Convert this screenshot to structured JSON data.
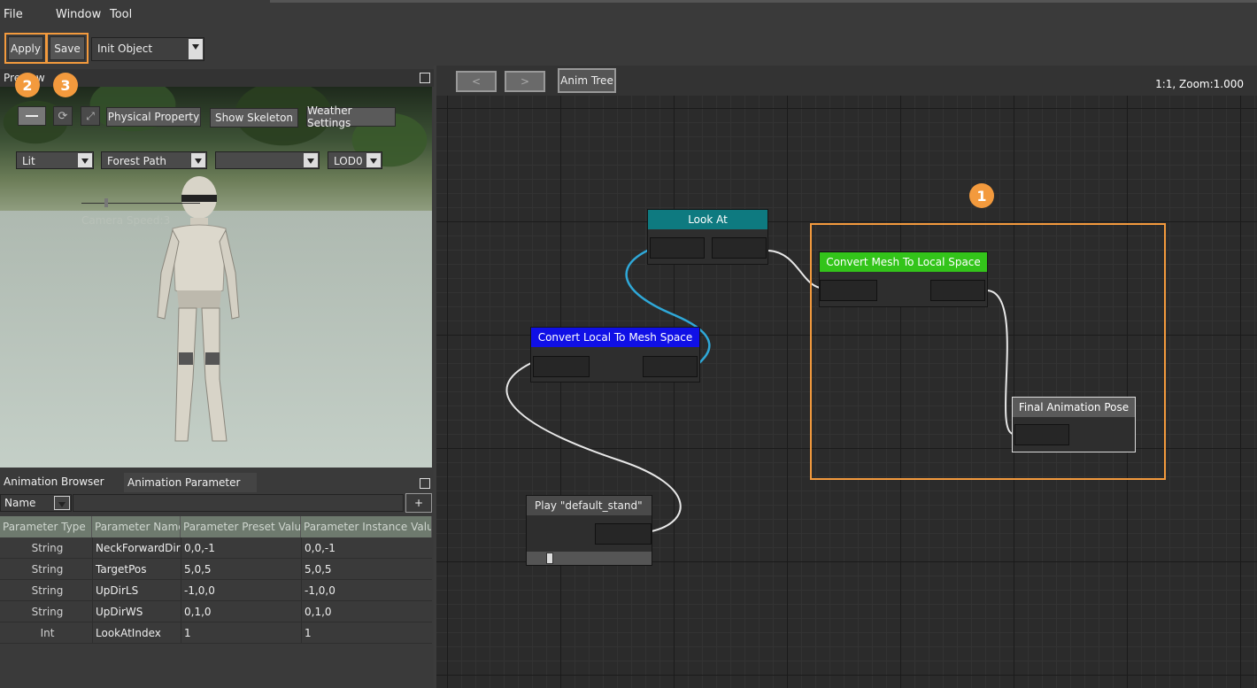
{
  "menu": {
    "file": "File",
    "window": "Window",
    "tool": "Tool"
  },
  "toolbar": {
    "apply": "Apply",
    "save": "Save",
    "object_select": "Init Object"
  },
  "badges": {
    "one": "1",
    "two": "2",
    "three": "3"
  },
  "preview": {
    "title": "Preview",
    "buttons": {
      "physical_property": "Physical Property",
      "show_skeleton": "Show Skeleton",
      "weather_settings": "Weather Settings"
    },
    "combos": {
      "lighting": "Lit",
      "scene": "Forest Path",
      "empty": "",
      "lod": "LOD0"
    },
    "camera_speed_label": "Camera Speed:3"
  },
  "animation": {
    "tabs": [
      "Animation Browser",
      "Animation Parameter"
    ],
    "filter_value": "Name",
    "add_label": "+",
    "columns": [
      "Parameter Type",
      "Parameter Name",
      "Parameter Preset Value",
      "Parameter Instance Value"
    ],
    "rows": [
      {
        "type": "String",
        "name": "NeckForwardDir",
        "preset": "0,0,-1",
        "instance": "0,0,-1"
      },
      {
        "type": "String",
        "name": "TargetPos",
        "preset": "5,0,5",
        "instance": "5,0,5"
      },
      {
        "type": "String",
        "name": "UpDirLS",
        "preset": "-1,0,0",
        "instance": "-1,0,0"
      },
      {
        "type": "String",
        "name": "UpDirWS",
        "preset": "0,1,0",
        "instance": "0,1,0"
      },
      {
        "type": "Int",
        "name": "LookAtIndex",
        "preset": "1",
        "instance": "1"
      }
    ]
  },
  "graph": {
    "back_label": "<",
    "forward_label": ">",
    "anim_tree_label": "Anim Tree",
    "zoom_text": "1:1, Zoom:1.000",
    "nodes": {
      "look_at": "Look At",
      "convert_mesh_to_local": "Convert Mesh To Local Space",
      "convert_local_to_mesh": "Convert Local To Mesh Space",
      "final_pose": "Final Animation Pose",
      "play_default_stand": "Play \"default_stand\""
    }
  },
  "colors": {
    "highlight": "#f39a3d",
    "look_at_header": "#0e7a80",
    "mesh_to_local_header": "#33c41a",
    "local_to_mesh_header": "#1010e6",
    "final_pose_header": "#5a5a5a",
    "play_header": "#4a4a4a"
  }
}
